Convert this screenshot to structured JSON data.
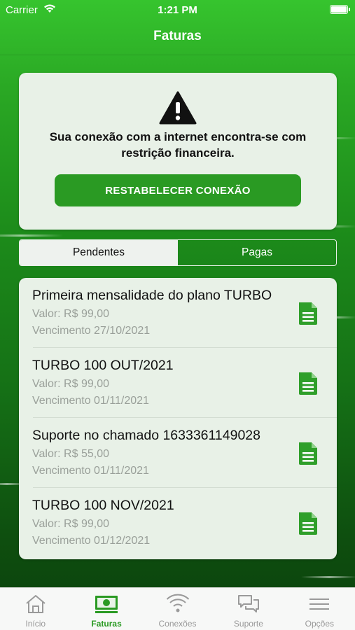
{
  "status_bar": {
    "carrier": "Carrier",
    "time": "1:21 PM"
  },
  "nav": {
    "title": "Faturas"
  },
  "alert": {
    "icon": "warning-icon",
    "message": "Sua conexão com a internet encontra-se com restrição financeira.",
    "button_label": "RESTABELECER CONEXÃO"
  },
  "segments": {
    "pending": "Pendentes",
    "paid": "Pagas",
    "selected": "Pendentes"
  },
  "invoices": [
    {
      "name": "Primeira mensalidade do plano TURBO",
      "value": "Valor: R$ 99,00",
      "due": "Vencimento 27/10/2021",
      "icon": "document-icon"
    },
    {
      "name": "TURBO 100 OUT/2021",
      "value": "Valor: R$ 99,00",
      "due": "Vencimento 01/11/2021",
      "icon": "document-icon"
    },
    {
      "name": "Suporte no chamado 1633361149028",
      "value": "Valor: R$ 55,00",
      "due": "Vencimento 01/11/2021",
      "icon": "document-icon"
    },
    {
      "name": "TURBO 100 NOV/2021",
      "value": "Valor: R$ 99,00",
      "due": "Vencimento 01/12/2021",
      "icon": "document-icon"
    }
  ],
  "tabbar": {
    "tabs": [
      {
        "label": "Início",
        "icon": "home-icon"
      },
      {
        "label": "Faturas",
        "icon": "money-icon"
      },
      {
        "label": "Conexões",
        "icon": "wifi-icon"
      },
      {
        "label": "Suporte",
        "icon": "chat-icon"
      },
      {
        "label": "Opções",
        "icon": "menu-icon"
      }
    ],
    "active": "Faturas"
  },
  "colors": {
    "accent": "#2a9a23",
    "card": "#e8f1e7",
    "muted_text": "#9aa09a",
    "tab_inactive": "#999999"
  }
}
